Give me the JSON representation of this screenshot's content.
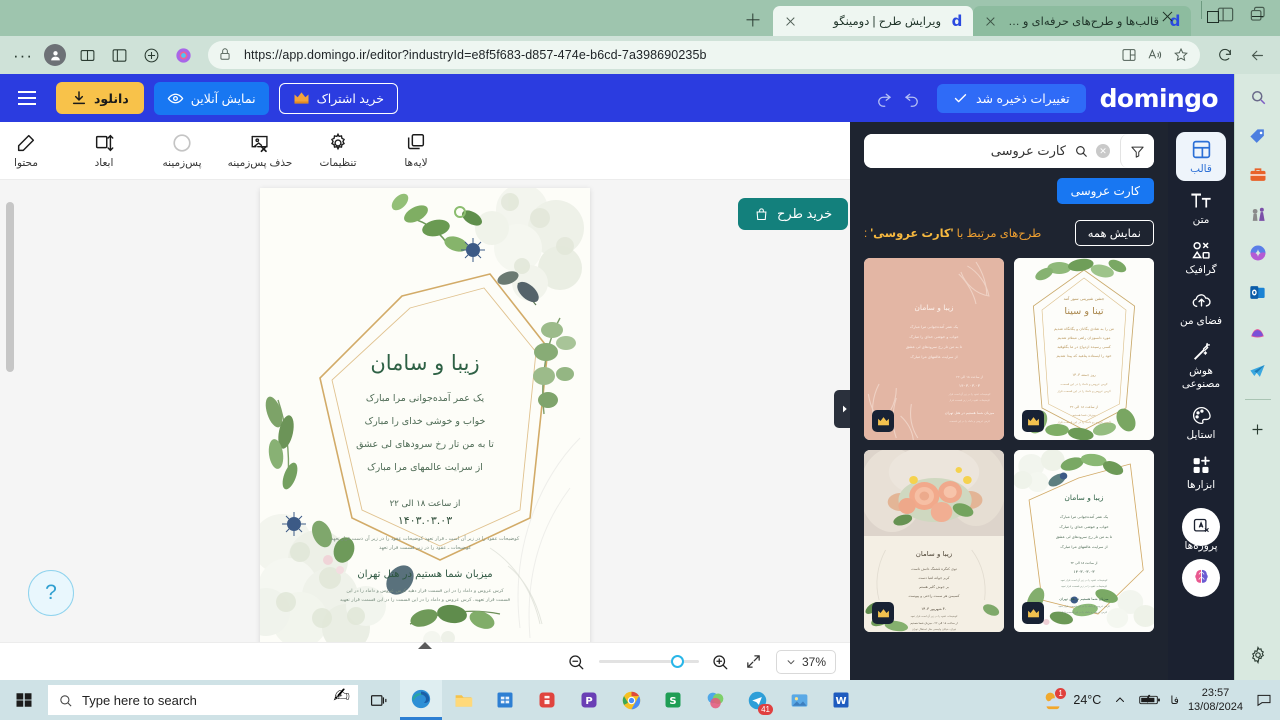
{
  "browser": {
    "tabs": [
      {
        "title": "قالب‌ها و طرح‌های حرفه‌ای و رایگان",
        "favicon": "domingo-d",
        "active": false
      },
      {
        "title": "ویرایش طرح | دومینگو",
        "favicon": "domingo-d",
        "active": true
      }
    ],
    "new_tab_label": "+",
    "address": "https://app.domingo.ir/editor?industryId=e8f5f683-d857-474e-b6cd-7a398690235b",
    "icons": {
      "back": "back-arrow-icon",
      "refresh": "refresh-icon",
      "lock": "lock-icon",
      "split_screen": "split-screen-icon",
      "read_aloud": "read-aloud-icon",
      "favorite": "star-icon",
      "copilot": "copilot-icon",
      "collections": "collections-icon",
      "browser_essentials": "browser-essentials-icon",
      "profile": "profile-avatar-icon",
      "settings_more": "more-options-icon"
    },
    "window_controls": {
      "minimize": "minimize-icon",
      "maximize": "maximize-icon",
      "close": "close-icon"
    }
  },
  "edge_sidebar": {
    "items": [
      "search-icon",
      "shopping-tag-icon",
      "tools-briefcase-icon",
      "games-icon",
      "copilot-swirl-icon",
      "outlook-icon",
      "designer-icon",
      "telegram-icon"
    ],
    "add_label": "+",
    "settings": "gear-icon"
  },
  "app_header": {
    "logo": "domingo",
    "saved_label": "تغییرات ذخیره شد",
    "saved_icon": "check-icon",
    "undo_icon": "undo-icon",
    "redo_icon": "redo-icon",
    "subscribe_label": "خرید اشتراک",
    "subscribe_icon": "crown-icon",
    "preview_label": "نمایش آنلاین",
    "preview_icon": "eye-icon",
    "download_label": "دانلود",
    "download_icon": "download-icon",
    "menu_icon": "hamburger-menu-icon",
    "colors": {
      "header_bg": "#2b3ce0",
      "saved_bg": "#2f6bf7",
      "preview_bg": "#1877f2",
      "download_bg": "#f8c24a"
    }
  },
  "edit_toolbar": {
    "items": [
      {
        "label": "محتوا",
        "icon": "edit-pencil-icon"
      },
      {
        "label": "ابعاد",
        "icon": "dimensions-icon"
      },
      {
        "label": "پس‌زمینه",
        "icon": "background-circle-icon"
      },
      {
        "label": "حذف پس‌زمینه",
        "icon": "remove-background-icon"
      },
      {
        "label": "تنظیمات",
        "icon": "gear-icon"
      },
      {
        "label": "لایه‌ها",
        "icon": "layers-icon"
      }
    ]
  },
  "canvas": {
    "buy_design_label": "خرید طرح",
    "buy_design_icon": "shopping-bag-icon",
    "collapse_icon": "chevron-right-icon",
    "help_icon": "question-mark-icon",
    "zoom_level": "37%",
    "zoom_chevron_icon": "chevron-down-icon",
    "fit_icon": "fit-screen-icon",
    "zoom_in_icon": "zoom-in-icon",
    "zoom_out_icon": "zoom-out-icon",
    "card": {
      "names": "زیبا و سامان",
      "lines": [
        "یک عمر آمده‌جوانی مرا مبارک",
        "خواب و خوشی خدای را مبارک",
        "تا به من تار رخ سرود‌های لی عشق",
        "از سرایت‌ عالمهای مرا مبارک"
      ],
      "time_line": "از ساعت ۱۸ الی ۲۲",
      "date": "۱۴۰۳.۰۳.۰۳",
      "fine_print_1": "کوضیحات عقود را در زیر آن است ـ قرار تعهد کوضیحات عقود را در زیر آن دست قرار تعهد",
      "fine_print_2": "کوضیحات ـ عقود را در زیر قسمت قرار تعهد",
      "venue": "میزبان شما هستیم در هتل تهران",
      "fine_print_3": "کرس عروس و داماد را در این قسمت قرار دهید کرس عروس و داماد را در این",
      "fine_print_4": "قسمت قرار تعهید. کرس عروس و داماد را در این قسمت را در این قسمت قرار تعهید"
    }
  },
  "template_panel": {
    "search_value": "کارت عروسی",
    "search_icon": "search-icon",
    "clear_icon": "clear-x-icon",
    "filter_icon": "filter-funnel-icon",
    "chip_label": "کارت عروسی",
    "related_prefix": "طرح‌های مرتبط با",
    "related_query": "'کارت عروسی'",
    "related_suffix": ":",
    "show_all_label": "نمایش همه",
    "crown_badge_icon": "crown-badge-icon",
    "templates": [
      {
        "name": "تینا و سینا",
        "style": "white-geometric-gold",
        "premium": true
      },
      {
        "name": "زیبا و سامان",
        "style": "dusty-rose-lineart",
        "premium": true
      },
      {
        "name": "زیبا و سامان",
        "style": "white-floral-hexagon",
        "premium": true
      },
      {
        "name": "زیبا و سامان",
        "style": "rose-bouquet-photo",
        "premium": true
      }
    ]
  },
  "app_rail": {
    "items": [
      {
        "label": "قالب",
        "icon": "template-grid-icon",
        "active": true
      },
      {
        "label": "متن",
        "icon": "text-icon",
        "active": false
      },
      {
        "label": "گرافیک",
        "icon": "shapes-icon",
        "active": false
      },
      {
        "label": "فضای من",
        "icon": "cloud-upload-icon",
        "active": false
      },
      {
        "label": "هوش مصنوعی",
        "icon": "magic-wand-icon",
        "active": false
      },
      {
        "label": "استایل",
        "icon": "palette-icon",
        "active": false
      },
      {
        "label": "ابزارها",
        "icon": "tools-grid-plus-icon",
        "active": false
      },
      {
        "label": "پروژه‌ها",
        "icon": "projects-icon",
        "active": false
      }
    ],
    "brain_fab_icon": "ai-brain-icon"
  },
  "taskbar": {
    "start_icon": "windows-start-icon",
    "search_placeholder": "Type here to search",
    "search_icon": "search-icon",
    "cortana_icon": "hand-pencil-icon",
    "task_view_icon": "task-view-icon",
    "apps": [
      {
        "icon": "edge-icon",
        "active": true
      },
      {
        "icon": "file-explorer-icon",
        "active": false
      },
      {
        "icon": "store-icon",
        "active": false
      },
      {
        "icon": "red-app-icon",
        "active": false
      },
      {
        "icon": "purple-p-icon",
        "active": false
      },
      {
        "icon": "chrome-icon",
        "active": false
      },
      {
        "icon": "green-s-icon",
        "active": false
      },
      {
        "icon": "colorful-app-icon",
        "active": false
      },
      {
        "icon": "telegram-icon",
        "active": false,
        "badge": "41"
      },
      {
        "icon": "photos-icon",
        "active": false
      },
      {
        "icon": "word-icon",
        "active": false
      }
    ],
    "tray": {
      "weather_icon": "weather-cloud-sun-icon",
      "weather_badge": "1",
      "temperature": "24°C",
      "chevron_icon": "show-hidden-icons-icon",
      "battery_icon": "battery-charging-icon",
      "language": "فا",
      "time": "23:57",
      "date": "13/08/2024",
      "action_center_icon": "action-center-icon"
    }
  }
}
